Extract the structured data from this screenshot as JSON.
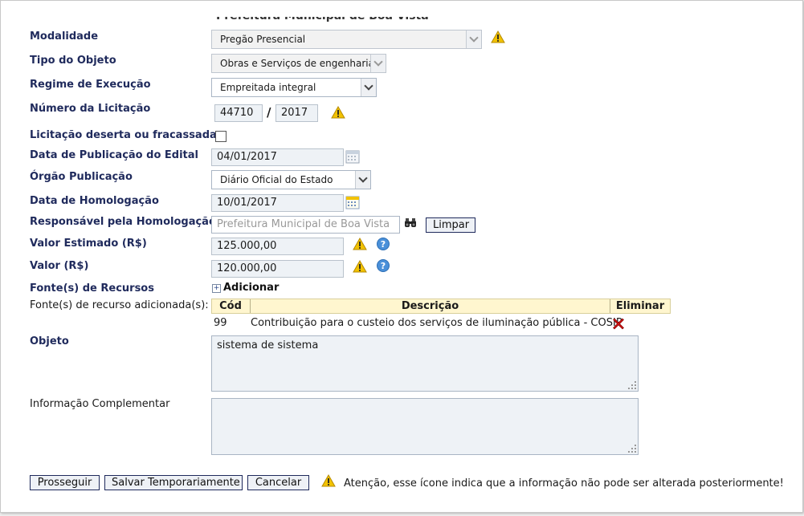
{
  "form": {
    "clipped_title": "Prefeitura Municipal de Boa Vista",
    "modalidade": {
      "label": "Modalidade",
      "value": "Pregão Presencial"
    },
    "tipo_objeto": {
      "label": "Tipo do Objeto",
      "value": "Obras e Serviços de engenharia"
    },
    "regime": {
      "label": "Regime de Execução",
      "value": "Empreitada integral"
    },
    "numero": {
      "label": "Número da Licitação",
      "number": "44710",
      "separator": "/",
      "year": "2017"
    },
    "deserta": {
      "label": "Licitação deserta ou fracassada"
    },
    "data_publicacao": {
      "label": "Data de Publicação do Edital",
      "value": "04/01/2017"
    },
    "orgao": {
      "label": "Órgão Publicação",
      "value": "Diário Oficial do Estado"
    },
    "data_homologacao": {
      "label": "Data de Homologação",
      "value": "10/01/2017"
    },
    "responsavel": {
      "label": "Responsável pela Homologação",
      "placeholder": "Prefeitura Municipal de Boa Vista",
      "clear_label": "Limpar"
    },
    "valor_estimado": {
      "label": "Valor Estimado (R$)",
      "value": "125.000,00"
    },
    "valor": {
      "label": "Valor (R$)",
      "value": "120.000,00"
    },
    "fontes": {
      "label": "Fonte(s) de Recursos",
      "add_label": "Adicionar"
    },
    "fontes_adicionadas": {
      "label": "Fonte(s) de recurso adicionada(s):",
      "headers": {
        "cod": "Cód",
        "descricao": "Descrição",
        "eliminar": "Eliminar"
      },
      "rows": [
        {
          "cod": "99",
          "descricao": "Contribuição para o custeio dos serviços de iluminação pública - COSIP"
        }
      ]
    },
    "objeto": {
      "label": "Objeto",
      "value": "sistema de sistema"
    },
    "info_complementar": {
      "label": "Informação Complementar",
      "value": ""
    }
  },
  "actions": {
    "prosseguir": "Prosseguir",
    "salvar": "Salvar Temporariamente",
    "cancelar": "Cancelar",
    "note": "Atenção, esse ícone indica que a informação não pode ser alterada posteriormente!"
  },
  "colors": {
    "label": "#1f2a5c",
    "warning": "#f2c200",
    "help": "#4a90d9",
    "delete": "#cc1111",
    "table_header": "#fff6cf"
  }
}
